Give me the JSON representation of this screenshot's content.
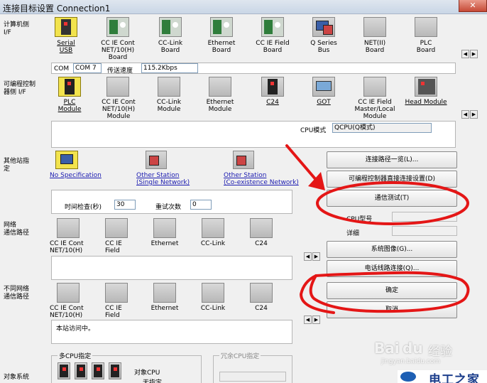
{
  "window": {
    "title": "连接目标设置 Connection1",
    "close_glyph": "✕"
  },
  "sections": {
    "pc_side": "计算机侧\nI/F",
    "plc_side": "可编程控制\n器侧 I/F",
    "other_station": "其他站指\n定",
    "network_route": "网络\n通信路径",
    "diff_network": "不同网络\n通信路径",
    "target_system": "对象系统"
  },
  "pc_if_items": [
    {
      "label": "Serial\nUSB"
    },
    {
      "label": "CC IE Cont\nNET/10(H)\nBoard"
    },
    {
      "label": "CC-Link\nBoard"
    },
    {
      "label": "Ethernet\nBoard"
    },
    {
      "label": "CC IE Field\nBoard"
    },
    {
      "label": "Q Series\nBus"
    },
    {
      "label": "NET(II)\nBoard"
    },
    {
      "label": "PLC\nBoard"
    }
  ],
  "pc_if_status": {
    "com_label": "COM",
    "com_value": "COM 7",
    "speed_label": "传送速度",
    "speed_value": "115.2Kbps"
  },
  "plc_if_items": [
    {
      "label": "PLC\nModule"
    },
    {
      "label": "CC IE Cont\nNET/10(H)\nModule"
    },
    {
      "label": "CC-Link\nModule"
    },
    {
      "label": "Ethernet\nModule"
    },
    {
      "label": "C24"
    },
    {
      "label": "GOT"
    },
    {
      "label": "CC IE Field\nMaster/Local\nModule"
    },
    {
      "label": "Head Module"
    }
  ],
  "cpu_mode": {
    "label": "CPU模式",
    "value": "QCPU(Q模式)"
  },
  "other_station_items": [
    {
      "label": "No Specification"
    },
    {
      "label": "Other Station\n(Single Network)"
    },
    {
      "label": "Other Station\n(Co-existence Network)"
    }
  ],
  "other_station_settings": {
    "time_check_label": "时间检查(秒)",
    "time_check_value": "30",
    "retry_label": "重试次数",
    "retry_value": "0"
  },
  "network_items": [
    {
      "label": "CC IE Cont\nNET/10(H)"
    },
    {
      "label": "CC IE\nField"
    },
    {
      "label": "Ethernet"
    },
    {
      "label": "CC-Link"
    },
    {
      "label": "C24"
    }
  ],
  "diff_network_items": [
    {
      "label": "CC IE Cont\nNET/10(H)"
    },
    {
      "label": "CC IE\nField"
    },
    {
      "label": "Ethernet"
    },
    {
      "label": "CC-Link"
    },
    {
      "label": "C24"
    }
  ],
  "status_text": "本站访问中。",
  "multi_cpu": {
    "title": "多CPU指定",
    "target_label": "对象CPU",
    "target_value": "无指定"
  },
  "redundant_cpu": {
    "title": "冗余CPU指定"
  },
  "buttons": {
    "connection_list": "连接路径一览(L)...",
    "direct_connect": "可编程控制器直接连接设置(D)",
    "comm_test": "通信测试(T)",
    "system_image": "系统图像(G)...",
    "phone_line": "电话线路连接(Q)...",
    "ok": "确定",
    "cancel": "取消"
  },
  "cpu_info": {
    "type_label": "CPU型号",
    "detail_label": "详细"
  },
  "scroll_glyphs": {
    "left": "◀",
    "right": "▶"
  },
  "watermark": {
    "brand": "Bai",
    "paw": "du",
    "suffix": "经验",
    "url": "jingyan.baidu.com"
  },
  "logo_text": "电工之家"
}
